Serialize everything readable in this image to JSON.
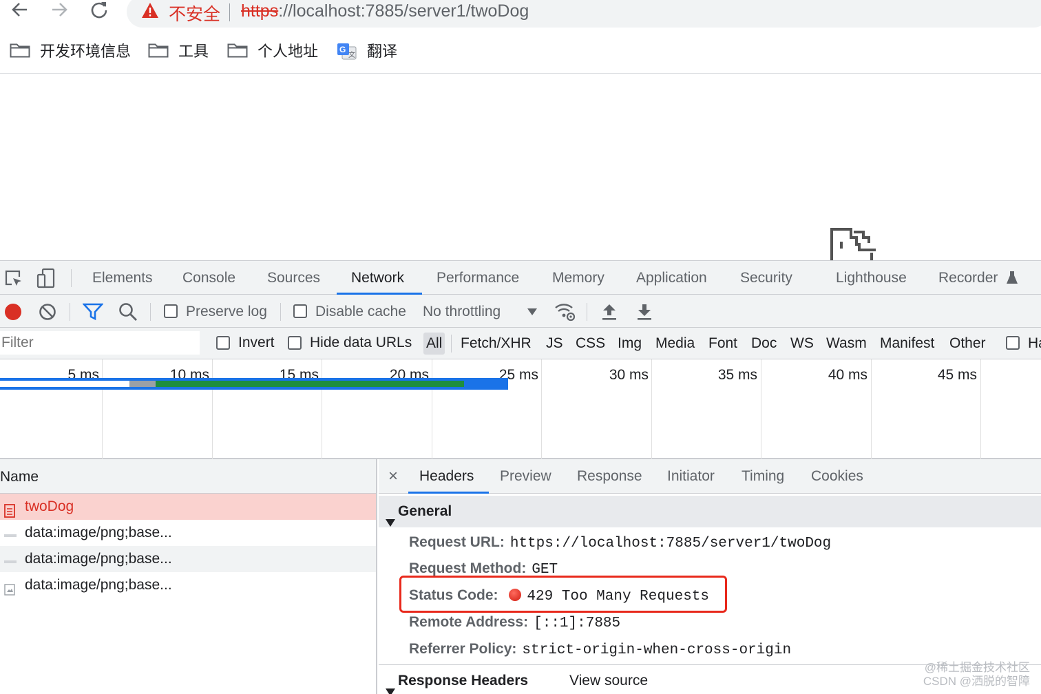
{
  "browser": {
    "insecure_label": "不安全",
    "url_scheme": "https",
    "url_rest": "://localhost:7885/server1/twoDog",
    "bookmarks": [
      {
        "label": "开发环境信息",
        "icon": "folder-icon"
      },
      {
        "label": "工具",
        "icon": "folder-icon"
      },
      {
        "label": "个人地址",
        "icon": "folder-icon"
      },
      {
        "label": "翻译",
        "icon": "google-translate-icon"
      }
    ]
  },
  "devtools": {
    "tabs": [
      "Elements",
      "Console",
      "Sources",
      "Network",
      "Performance",
      "Memory",
      "Application",
      "Security",
      "Lighthouse",
      "Recorder"
    ],
    "active_tab": "Network",
    "toolbar": {
      "preserve_log": "Preserve log",
      "disable_cache": "Disable cache",
      "throttling": "No throttling"
    },
    "filter": {
      "placeholder": "Filter",
      "invert": "Invert",
      "hide_data_urls": "Hide data URLs",
      "types": [
        "All",
        "Fetch/XHR",
        "JS",
        "CSS",
        "Img",
        "Media",
        "Font",
        "Doc",
        "WS",
        "Wasm",
        "Manifest",
        "Other"
      ],
      "truncated_label": "Ha"
    },
    "timeline_labels": [
      "5 ms",
      "10 ms",
      "15 ms",
      "20 ms",
      "25 ms",
      "30 ms",
      "35 ms",
      "40 ms",
      "45 ms"
    ],
    "name_header": "Name",
    "requests": [
      {
        "name": "twoDog",
        "error": true
      },
      {
        "name": "data:image/png;base...",
        "error": false
      },
      {
        "name": "data:image/png;base...",
        "error": false
      },
      {
        "name": "data:image/png;base...",
        "error": false
      }
    ],
    "detail": {
      "close": "×",
      "tabs": [
        "Headers",
        "Preview",
        "Response",
        "Initiator",
        "Timing",
        "Cookies"
      ],
      "active_tab": "Headers",
      "general_title": "General",
      "fields": {
        "request_url": {
          "key": "Request URL:",
          "value": "https://localhost:7885/server1/twoDog"
        },
        "request_method": {
          "key": "Request Method:",
          "value": "GET"
        },
        "status_code": {
          "key": "Status Code:",
          "value": "429 Too Many Requests"
        },
        "remote_address": {
          "key": "Remote Address:",
          "value": "[::1]:7885"
        },
        "referrer_policy": {
          "key": "Referrer Policy:",
          "value": "strict-origin-when-cross-origin"
        }
      },
      "response_headers_title": "Response Headers",
      "view_source": "View source"
    }
  },
  "watermark": {
    "line1": "@稀土掘金技术社区",
    "line2": "CSDN @洒脱的智障"
  },
  "colors": {
    "accent": "#1a73e8",
    "error": "#d93025",
    "highlight_box": "#e8291c",
    "row_error_bg": "#fad2cf"
  }
}
